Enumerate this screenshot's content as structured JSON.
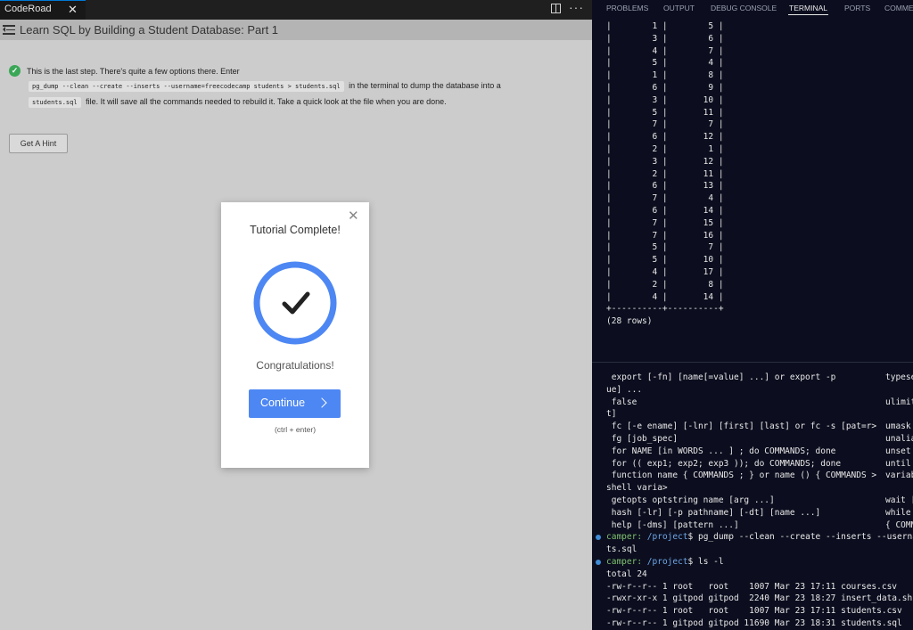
{
  "editor": {
    "tab_title": "CodeRoad",
    "tab_close": "✕",
    "more": "···"
  },
  "header": {
    "title": "Learn SQL by Building a Student Database: Part 1"
  },
  "step": {
    "line1": "This is the last step. There's quite a few options there. Enter",
    "command": "pg_dump --clean --create --inserts --username=freecodecamp students > students.sql",
    "line2_after": "in the terminal to dump the database into a",
    "file": "students.sql",
    "line3_after": "file. It will save all the commands needed to rebuild it. Take a quick look at the file when you are done."
  },
  "hint_button": "Get A Hint",
  "modal": {
    "close": "✕",
    "title": "Tutorial Complete!",
    "message": "Congratulations!",
    "continue_label": "Continue",
    "shortcut": "(ctrl + enter)"
  },
  "panel_tabs": [
    "PROBLEMS",
    "OUTPUT",
    "DEBUG CONSOLE",
    "TERMINAL",
    "PORTS",
    "COMME"
  ],
  "active_tab": "TERMINAL",
  "terminal_top": [
    "|        1 |        5 |",
    "|        3 |        6 |",
    "|        4 |        7 |",
    "|        5 |        4 |",
    "|        1 |        8 |",
    "|        6 |        9 |",
    "|        3 |       10 |",
    "|        5 |       11 |",
    "|        7 |        7 |",
    "|        6 |       12 |",
    "|        2 |        1 |",
    "|        3 |       12 |",
    "|        2 |       11 |",
    "|        6 |       13 |",
    "|        7 |        4 |",
    "|        6 |       14 |",
    "|        7 |       15 |",
    "|        7 |       16 |",
    "|        5 |        7 |",
    "|        5 |       10 |",
    "|        4 |       17 |",
    "|        2 |        8 |",
    "|        4 |       14 |",
    "+----------+----------+",
    "(28 rows)"
  ],
  "help_lines": [
    {
      "left": " export [-fn] [name[=value] ...] or export -p",
      "right": "typese"
    },
    {
      "left": "ue] ...",
      "right": ""
    },
    {
      "left": " false",
      "right": "ulimit"
    },
    {
      "left": "t]",
      "right": ""
    },
    {
      "left": " fc [-e ename] [-lnr] [first] [last] or fc -s [pat=r>",
      "right": "umask"
    },
    {
      "left": " fg [job_spec]",
      "right": "unalia"
    },
    {
      "left": " for NAME [in WORDS ... ] ; do COMMANDS; done",
      "right": "unset"
    },
    {
      "left": " for (( exp1; exp2; exp3 )); do COMMANDS; done",
      "right": "until"
    },
    {
      "left": " function name { COMMANDS ; } or name () { COMMANDS >",
      "right": "variab"
    },
    {
      "left": "shell varia>",
      "right": ""
    },
    {
      "left": " getopts optstring name [arg ...]",
      "right": "wait ["
    },
    {
      "left": " hash [-lr] [-p pathname] [-dt] [name ...]",
      "right": "while"
    },
    {
      "left": " help [-dms] [pattern ...]",
      "right": "{ COMM"
    }
  ],
  "prompt": {
    "user": "camper:",
    "path": "/project",
    "cmd1": "$ pg_dump --clean --create --inserts --userna",
    "cmd1_wrap": "ts.sql",
    "cmd2": "$ ls -l"
  },
  "ls_output": [
    "total 24",
    "-rw-r--r-- 1 root   root    1007 Mar 23 17:11 courses.csv",
    "-rwxr-xr-x 1 gitpod gitpod  2240 Mar 23 18:27 insert_data.sh",
    "-rw-r--r-- 1 root   root    1007 Mar 23 17:11 students.csv",
    "-rw-r--r-- 1 gitpod gitpod 11690 Mar 23 18:31 students.sql"
  ]
}
